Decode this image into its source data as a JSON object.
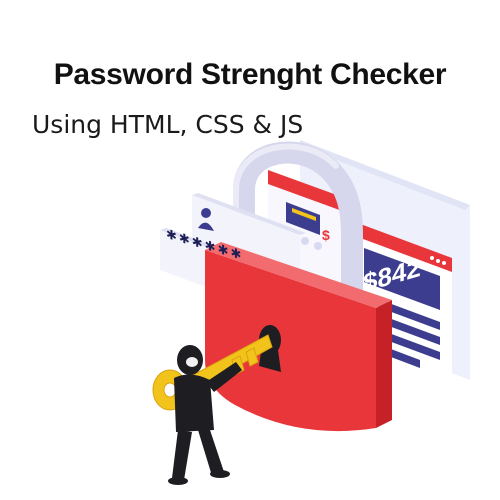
{
  "header": {
    "title": "Password Strenght Checker",
    "subtitle": "Using HTML, CSS & JS"
  },
  "illustration": {
    "card_amount": "$842",
    "card_amount_partial": "$",
    "password_mask": "✱✱✱✱✱✱",
    "colors": {
      "lock_body": "#e8363b",
      "lock_shadow": "#c52127",
      "shackle": "#d9d9ee",
      "panel": "#eceef9",
      "card_navy": "#3d3d8f",
      "key": "#f2c41b",
      "figure": "#1e1e22"
    }
  }
}
